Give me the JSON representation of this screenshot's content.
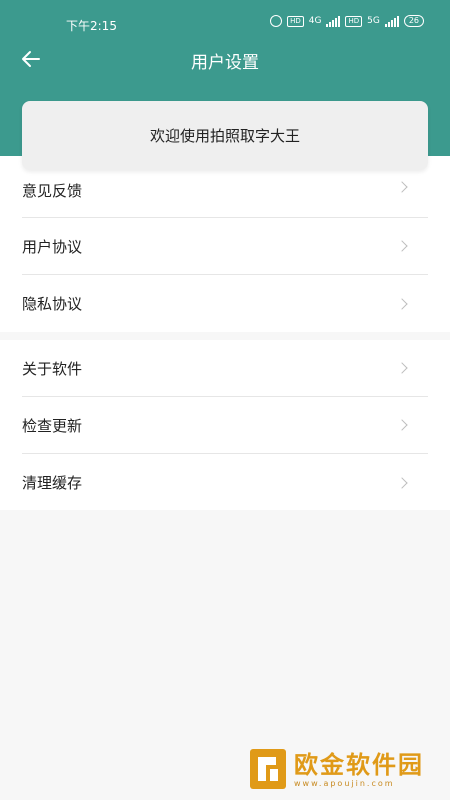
{
  "status_bar": {
    "time": "下午2:15",
    "net1": "4G",
    "net2": "5G",
    "hd": "HD",
    "battery": "26"
  },
  "nav": {
    "title": "用户设置"
  },
  "welcome": {
    "text": "欢迎使用拍照取字大王"
  },
  "group1": [
    {
      "label": "意见反馈"
    },
    {
      "label": "用户协议"
    },
    {
      "label": "隐私协议"
    }
  ],
  "group2": [
    {
      "label": "关于软件"
    },
    {
      "label": "检查更新"
    },
    {
      "label": "清理缓存"
    }
  ],
  "watermark": {
    "name": "欧金软件园",
    "url": "www.apoujin.com"
  },
  "colors": {
    "header": "#3c9a8e",
    "background": "#f7f7f7",
    "watermark": "#e09a18"
  }
}
